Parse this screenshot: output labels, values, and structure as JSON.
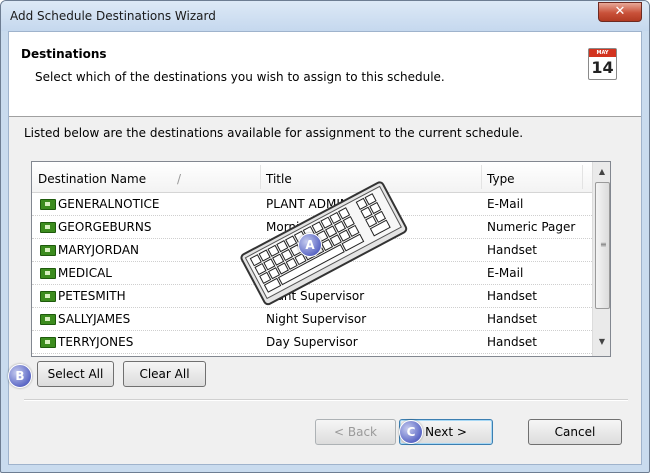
{
  "window": {
    "title": "Add Schedule Destinations Wizard",
    "close_glyph": "✕"
  },
  "header": {
    "title": "Destinations",
    "subtitle": "Select which of the destinations you wish to assign to this schedule.",
    "calendar_icon": {
      "name": "calendar-icon",
      "month": "MAY",
      "day": "14"
    }
  },
  "main": {
    "description": "Listed below are the destinations available for assignment to the current schedule.",
    "columns": [
      "Destination Name",
      "Title",
      "Type"
    ],
    "sort_glyph": "/",
    "rows": [
      {
        "name": "GENERALNOTICE",
        "title": "PLANT ADMIN",
        "type": "E-Mail"
      },
      {
        "name": "GEORGEBURNS",
        "title": "Morning",
        "type": "Numeric Pager"
      },
      {
        "name": "MARYJORDAN",
        "title": "",
        "type": "Handset"
      },
      {
        "name": "MEDICAL",
        "title": "",
        "type": "E-Mail"
      },
      {
        "name": "PETESMITH",
        "title": "Plant Supervisor",
        "type": "Handset"
      },
      {
        "name": "SALLYJAMES",
        "title": "Night Supervisor",
        "type": "Handset"
      },
      {
        "name": "TERRYJONES",
        "title": "Day Supervisor",
        "type": "Handset"
      }
    ],
    "select_all_label": "Select All",
    "clear_all_label": "Clear All"
  },
  "footer": {
    "back_label": "< Back",
    "next_label": "Next >",
    "cancel_label": "Cancel"
  },
  "callouts": {
    "a": "A",
    "b": "B",
    "c": "C"
  },
  "colors": {
    "accent": "#5d69c6",
    "close": "#c9523a",
    "icon_green": "#3c8c1e"
  }
}
